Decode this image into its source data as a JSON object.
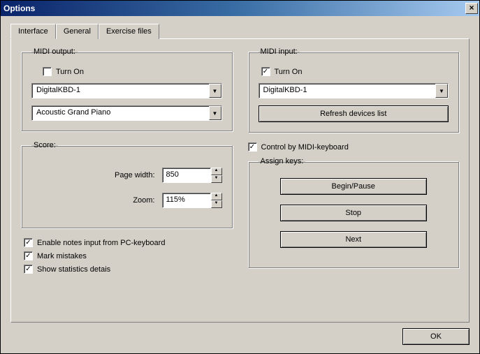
{
  "window": {
    "title": "Options"
  },
  "tabs": {
    "interface": "Interface",
    "general": "General",
    "exercise": "Exercise files",
    "active": 0
  },
  "midi_output": {
    "legend": "MIDI output:",
    "turn_on_label": "Turn On",
    "turn_on_checked": false,
    "device": "DigitalKBD-1",
    "instrument": "Acoustic Grand Piano"
  },
  "score": {
    "legend": "Score:",
    "page_width_label": "Page width:",
    "page_width_value": "850",
    "zoom_label": "Zoom:",
    "zoom_value": "115%"
  },
  "left_checks": {
    "enable_notes": {
      "label": "Enable notes input from PC-keyboard",
      "checked": true
    },
    "mark_mistakes": {
      "label": "Mark mistakes",
      "checked": true
    },
    "show_stats": {
      "label": "Show statistics detais",
      "checked": true
    }
  },
  "midi_input": {
    "legend": "MIDI input:",
    "turn_on_label": "Turn On",
    "turn_on_checked": true,
    "device": "DigitalKBD-1",
    "refresh_label": "Refresh devices list"
  },
  "control_midi": {
    "label": "Control by MIDI-keyboard",
    "checked": true
  },
  "assign": {
    "legend": "Assign keys:",
    "begin": "Begin/Pause",
    "stop": "Stop",
    "next": "Next"
  },
  "footer": {
    "ok": "OK"
  }
}
